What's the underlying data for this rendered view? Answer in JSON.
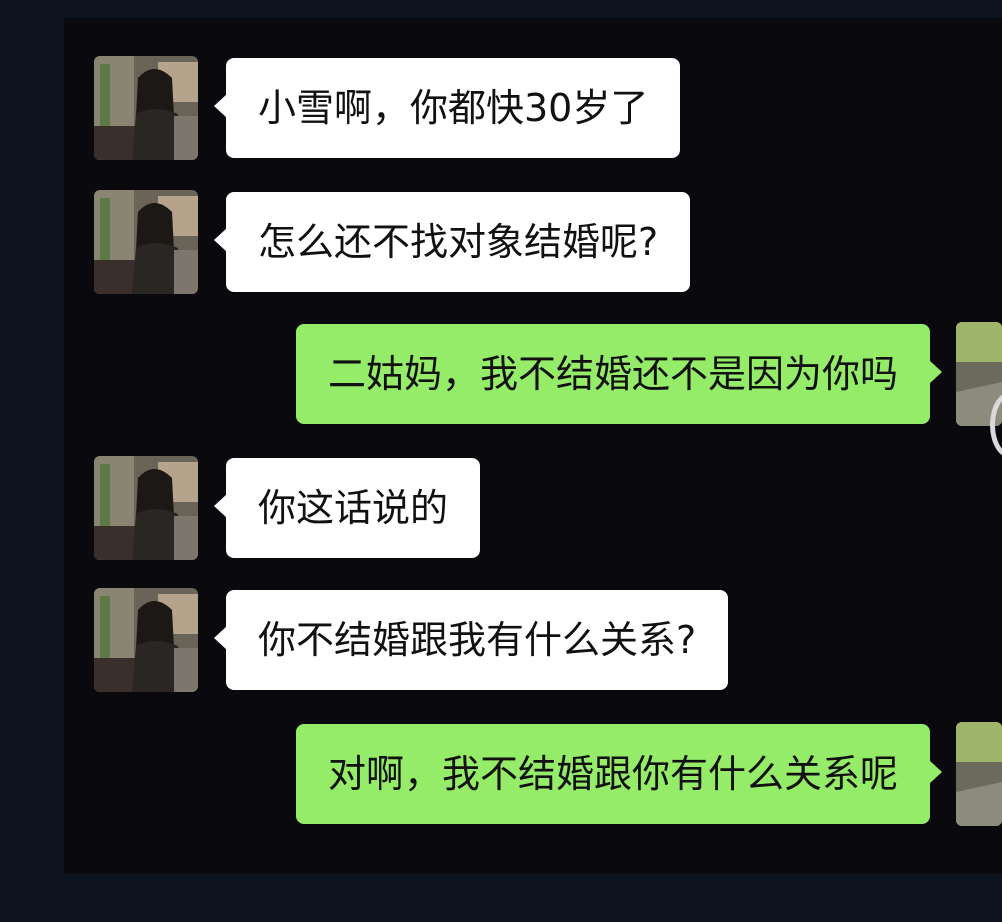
{
  "colors": {
    "background": "#0a0a0e",
    "incoming_bubble": "#ffffff",
    "outgoing_bubble": "#95ec69",
    "text": "#111111"
  },
  "messages": [
    {
      "side": "left",
      "text": "小雪啊，你都快30岁了",
      "avatar": "aunt-avatar"
    },
    {
      "side": "left",
      "text": "怎么还不找对象结婚呢?",
      "avatar": "aunt-avatar"
    },
    {
      "side": "right",
      "text": "二姑妈，我不结婚还不是因为你吗",
      "avatar": "self-avatar"
    },
    {
      "side": "left",
      "text": "你这话说的",
      "avatar": "aunt-avatar"
    },
    {
      "side": "left",
      "text": "你不结婚跟我有什么关系?",
      "avatar": "aunt-avatar"
    },
    {
      "side": "right",
      "text": "对啊，我不结婚跟你有什么关系呢",
      "avatar": "self-avatar"
    }
  ]
}
